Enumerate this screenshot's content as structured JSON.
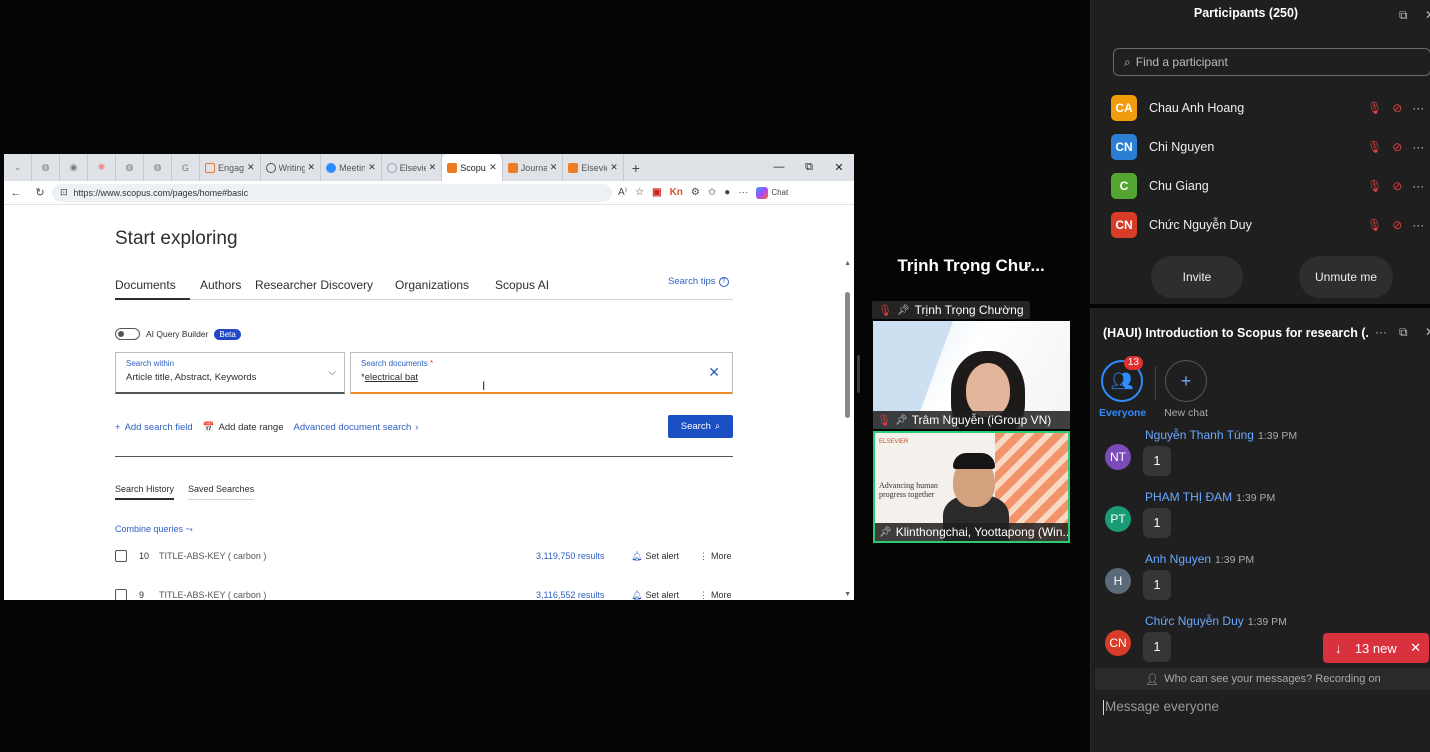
{
  "browser": {
    "tabs": [
      {
        "label": "Engage",
        "color": "#f07b25"
      },
      {
        "label": "Writing",
        "color": "#555555"
      },
      {
        "label": "Meetin",
        "color": "#2d8cff"
      },
      {
        "label": "Elsevie",
        "color": "#8fa0b4"
      },
      {
        "label": "Scopus",
        "color": "#f07b25",
        "active": true
      },
      {
        "label": "Journal",
        "color": "#f07b25"
      },
      {
        "label": "Elsevier",
        "color": "#f07b25"
      }
    ],
    "url": "https://www.scopus.com/pages/home#basic",
    "chat_label": "Chat"
  },
  "scopus": {
    "title": "Start exploring",
    "tabs": [
      "Documents",
      "Authors",
      "Researcher Discovery",
      "Organizations",
      "Scopus AI"
    ],
    "search_tips": "Search tips",
    "ai_query_builder": "AI Query Builder",
    "beta": "Beta",
    "search_within_label": "Search within",
    "search_within_value": "Article title, Abstract, Keywords",
    "search_docs_label": "Search documents",
    "search_docs_required": "*",
    "search_docs_value": "electrical bat",
    "add_search_field": "Add search field",
    "add_date_range": "Add date range",
    "advanced_search": "Advanced document search",
    "search_button": "Search",
    "history_tabs": [
      "Search History",
      "Saved Searches"
    ],
    "combine_queries": "Combine queries",
    "history": [
      {
        "num": "10",
        "query": "TITLE-ABS-KEY ( carbon )",
        "results": "3,119,750 results",
        "alert": "Set alert",
        "more": "More"
      },
      {
        "num": "9",
        "query": "TITLE-ABS-KEY ( carbon )",
        "results": "3,116,552 results",
        "alert": "Set alert",
        "more": "More"
      }
    ]
  },
  "video": {
    "speaker": "Trịnh Trọng Chư...",
    "speaker_label": "Trịnh Trọng Chường",
    "tile1": "Trâm Nguyễn (iGroup VN)",
    "tile2": "Klinthongchai, Yoottapong (Win...",
    "tile2_slide_brand": "ELSEVIER",
    "tile2_slide_text_1": "Advancing human",
    "tile2_slide_text_2": "progress together"
  },
  "participants": {
    "title": "Participants (250)",
    "search_placeholder": "Find a participant",
    "list": [
      {
        "initials": "CA",
        "name": "Chau Anh Hoang",
        "color": "#f29b0c"
      },
      {
        "initials": "CN",
        "name": "Chi Nguyen",
        "color": "#2a7fd4"
      },
      {
        "initials": "C",
        "name": "Chu Giang",
        "color": "#55a630"
      },
      {
        "initials": "CN",
        "name": "Chức Nguyễn Duy",
        "color": "#d63c28"
      }
    ],
    "invite": "Invite",
    "unmute": "Unmute me"
  },
  "chat": {
    "title": "(HAUI) Introduction to Scopus for research (...",
    "everyone": "Everyone",
    "everyone_badge": "13",
    "new_chat": "New chat",
    "messages": [
      {
        "initials": "NT",
        "name": "Nguyễn Thanh Tùng",
        "time": "1:39 PM",
        "text": "1",
        "color": "#7b4bb8"
      },
      {
        "initials": "PT",
        "name": "PHAM THỊ ĐAM",
        "time": "1:39 PM",
        "text": "1",
        "color": "#1a9b77"
      },
      {
        "initials": "H",
        "name": "Anh Nguyen",
        "time": "1:39 PM",
        "text": "1",
        "color": "#5a6a78"
      },
      {
        "initials": "CN",
        "name": "Chức Nguyễn Duy",
        "time": "1:39 PM",
        "text": "1",
        "color": "#d63c28"
      }
    ],
    "new_count": "13 new",
    "who_can_see": "Who can see your messages? Recording on",
    "input_placeholder": "Message everyone"
  }
}
